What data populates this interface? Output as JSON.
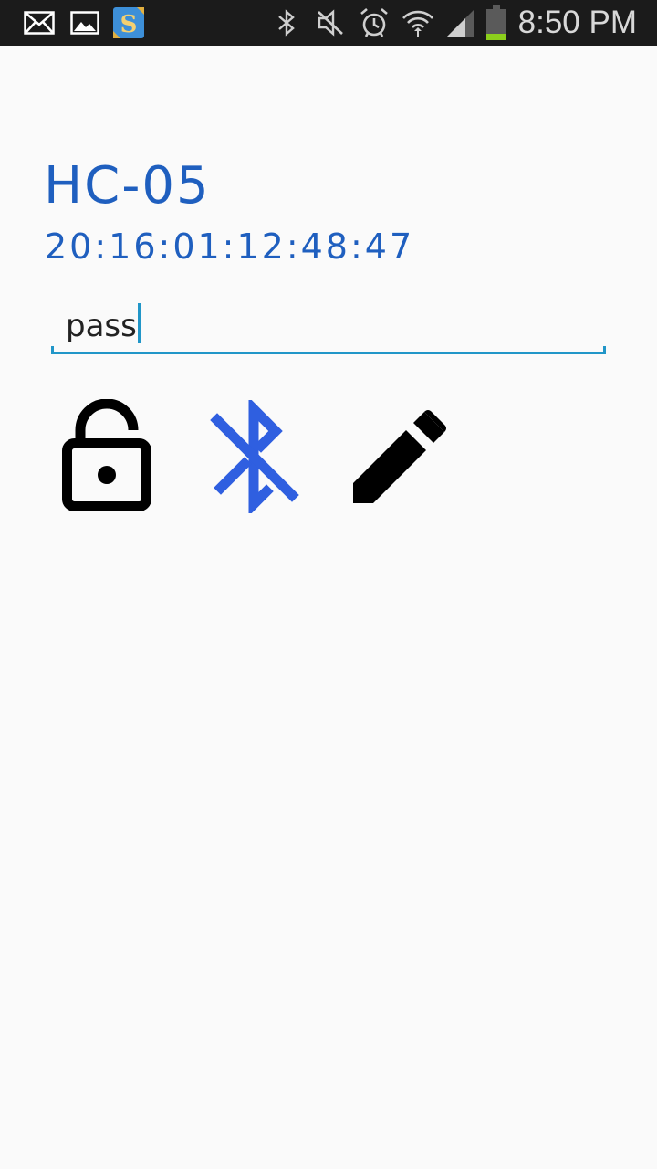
{
  "status_bar": {
    "time": "8:50 PM",
    "notification_icons": [
      "mail-icon",
      "image-icon",
      "sketch-app-icon"
    ],
    "system_icons": [
      "bluetooth-icon",
      "mute-icon",
      "alarm-icon",
      "wifi-icon",
      "signal-icon",
      "battery-icon"
    ]
  },
  "device": {
    "name": "HC-05",
    "address": "20:16:01:12:48:47"
  },
  "password_field": {
    "value": "pass"
  },
  "actions": [
    "unlock-icon",
    "bluetooth-disabled-icon",
    "edit-pencil-icon"
  ],
  "colors": {
    "accent_blue": "#1f5fbf",
    "field_underline": "#2196c8",
    "bluetooth_icon": "#2f5fe0",
    "status_bar_bg": "#1b1b1b",
    "background": "#fafafa"
  }
}
